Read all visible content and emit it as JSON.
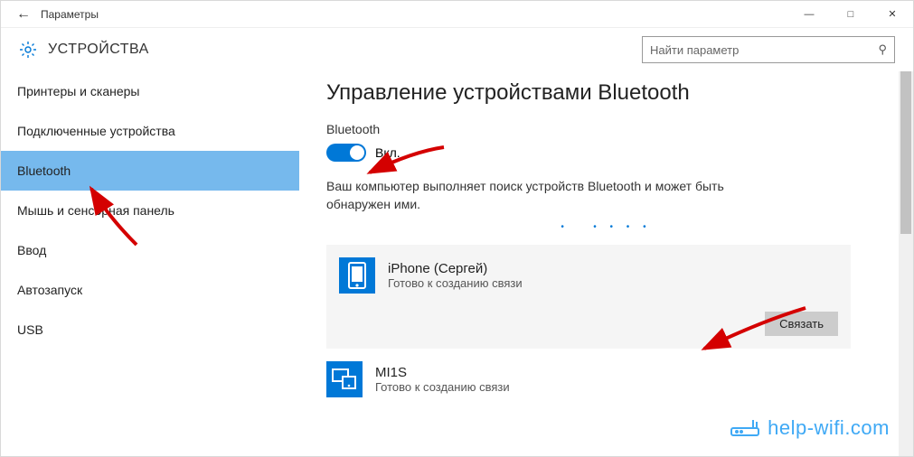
{
  "window": {
    "title": "Параметры"
  },
  "header": {
    "title": "УСТРОЙСТВА"
  },
  "search": {
    "placeholder": "Найти параметр"
  },
  "sidebar": {
    "items": [
      {
        "label": "Принтеры и сканеры"
      },
      {
        "label": "Подключенные устройства"
      },
      {
        "label": "Bluetooth"
      },
      {
        "label": "Мышь и сенсорная панель"
      },
      {
        "label": "Ввод"
      },
      {
        "label": "Автозапуск"
      },
      {
        "label": "USB"
      }
    ],
    "selected_index": 2
  },
  "page": {
    "title": "Управление устройствами Bluetooth",
    "toggle_section_label": "Bluetooth",
    "toggle_state_label": "Вкл.",
    "status_text": "Ваш компьютер выполняет поиск устройств Bluetooth и может быть обнаружен ими."
  },
  "devices": [
    {
      "name": "iPhone (Сергей)",
      "status": "Готово к созданию связи",
      "icon": "phone",
      "selected": true,
      "action_label": "Связать"
    },
    {
      "name": "MI1S",
      "status": "Готово к созданию связи",
      "icon": "device",
      "selected": false
    }
  ],
  "watermark": {
    "text": "help-wifi.com"
  }
}
